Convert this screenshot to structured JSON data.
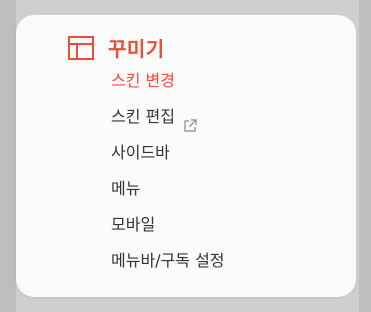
{
  "section": {
    "title": "꾸미기",
    "icon": "layout-icon",
    "accent_color": "#ef4a3a"
  },
  "menu": {
    "items": [
      {
        "label": "스킨 변경",
        "active": true
      },
      {
        "label": "스킨 편집",
        "external": true,
        "icon": "external-link-icon"
      },
      {
        "label": "사이드바"
      },
      {
        "label": "메뉴"
      },
      {
        "label": "모바일"
      },
      {
        "label": "메뉴바/구독 설정"
      }
    ]
  }
}
